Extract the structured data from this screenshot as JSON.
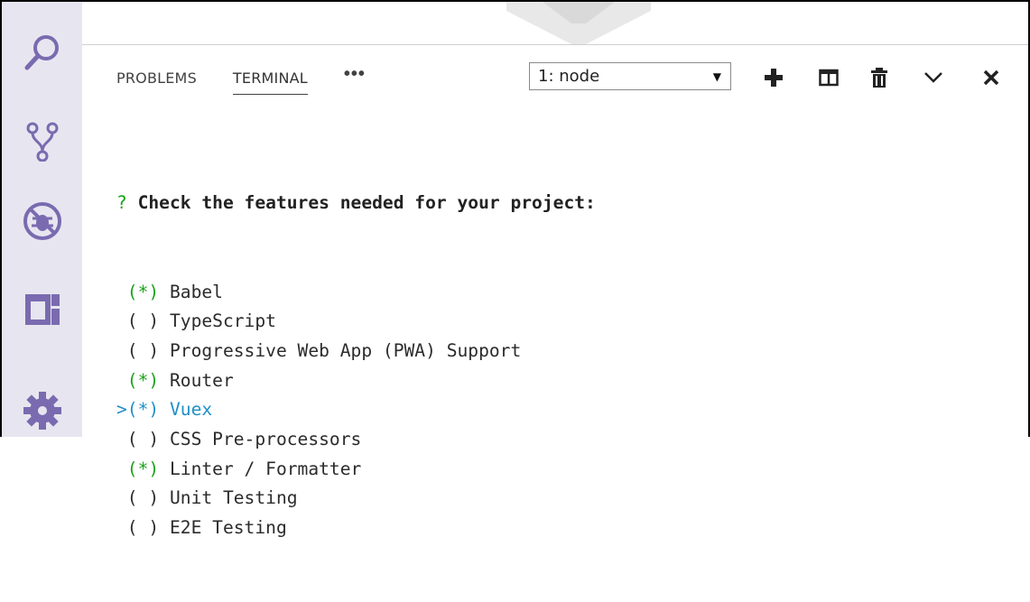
{
  "panel": {
    "tabs": [
      {
        "label": "PROBLEMS",
        "active": false
      },
      {
        "label": "TERMINAL",
        "active": true
      }
    ],
    "more_label": "•••",
    "terminal_select": {
      "value": "1: node",
      "arrow": "▼"
    }
  },
  "toolbar": {
    "icons": [
      "add-terminal-icon",
      "split-terminal-icon",
      "trash-icon",
      "chevron-down-icon",
      "close-icon"
    ]
  },
  "activity_bar": {
    "icons": [
      "search-icon",
      "source-control-icon",
      "debug-icon",
      "extensions-icon",
      "gear-icon"
    ]
  },
  "terminal": {
    "prompt_mark": "?",
    "question": "Check the features needed for your project:",
    "options": [
      {
        "cursor": " ",
        "mark": "(*)",
        "label": "Babel",
        "checked": true,
        "selected": false
      },
      {
        "cursor": " ",
        "mark": "( )",
        "label": "TypeScript",
        "checked": false,
        "selected": false
      },
      {
        "cursor": " ",
        "mark": "( )",
        "label": "Progressive Web App (PWA) Support",
        "checked": false,
        "selected": false
      },
      {
        "cursor": " ",
        "mark": "(*)",
        "label": "Router",
        "checked": true,
        "selected": false
      },
      {
        "cursor": ">",
        "mark": "(*)",
        "label": "Vuex",
        "checked": true,
        "selected": true
      },
      {
        "cursor": " ",
        "mark": "( )",
        "label": "CSS Pre-processors",
        "checked": false,
        "selected": false
      },
      {
        "cursor": " ",
        "mark": "(*)",
        "label": "Linter / Formatter",
        "checked": true,
        "selected": false
      },
      {
        "cursor": " ",
        "mark": "( )",
        "label": "Unit Testing",
        "checked": false,
        "selected": false
      },
      {
        "cursor": " ",
        "mark": "( )",
        "label": "E2E Testing",
        "checked": false,
        "selected": false
      }
    ]
  },
  "colors": {
    "activity_bar_bg": "#e7e6f0",
    "activity_icon": "#7a6bb0",
    "checked_green": "#1aa31a",
    "selected_cyan": "#1f8fc8"
  }
}
